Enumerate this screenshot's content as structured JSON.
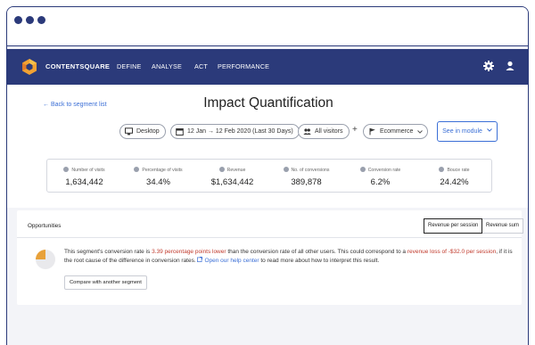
{
  "nav": {
    "brand": "CONTENTSQUARE",
    "links": [
      "DEFINE",
      "ANALYSE",
      "ACT",
      "PERFORMANCE"
    ]
  },
  "header": {
    "back_link": "← Back to segment list",
    "title": "Impact Quantification"
  },
  "filters": {
    "device": "Desktop",
    "date_range": "12 Jan → 12 Feb 2020 (Last 30 Days)",
    "visitors": "All visitors",
    "plus": "+",
    "segment": "Ecommerce",
    "see_in_module": "See in module"
  },
  "metrics": [
    {
      "label": "Number of visits",
      "value": "1,634,442"
    },
    {
      "label": "Percentage of visits",
      "value": "34.4%"
    },
    {
      "label": "Revenue",
      "value": "$1,634,442"
    },
    {
      "label": "No. of conversions",
      "value": "389,878"
    },
    {
      "label": "Conversion rate",
      "value": "6.2%"
    },
    {
      "label": "Bouce rate",
      "value": "24.42%"
    }
  ],
  "opportunities": {
    "title": "Opportunities",
    "toggle_active": "Revenue per session",
    "toggle_other": "Revenue sum",
    "text_1": "This segment's conversion rate is ",
    "highlight_1": "3.39 percentage points lower",
    "text_2": " than the conversion rate of all other users. This could correspond to a ",
    "highlight_2": "revenue loss of -$32.0 per session",
    "text_3": ", if it is the root cause of the difference in conversion rates. ",
    "help_link": "Open our help center",
    "text_4": " to read more about how to interpret this result.",
    "compare_button": "Compare with another segment"
  },
  "colors": {
    "navy": "#2b3a7a",
    "accent_blue": "#3b6fd6",
    "alert_red": "#c0392b",
    "pie_orange": "#e8a13a"
  }
}
